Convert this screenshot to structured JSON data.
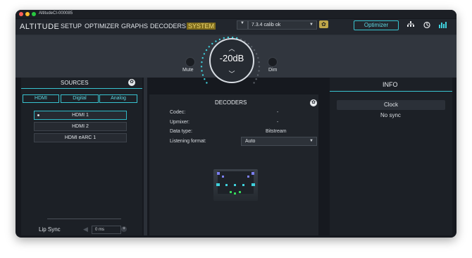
{
  "window": {
    "title": "AltitudeCI-000085"
  },
  "menu": {
    "logo": "ALTITUDE",
    "items": [
      "SETUP",
      "OPTIMIZER",
      "GRAPHS",
      "DECODERS",
      "SYSTEM"
    ],
    "active": "SYSTEM"
  },
  "toolbar": {
    "source_dropdown": "",
    "preset_dropdown": "7.3.4 calib ok",
    "optimizer_label": "Optimizer"
  },
  "volume": {
    "value": "-20dB",
    "mute_label": "Mute",
    "dim_label": "Dim"
  },
  "sources": {
    "title": "SOURCES",
    "tabs": [
      "HDMI",
      "Digital",
      "Analog"
    ],
    "items": [
      "HDMI 1",
      "HDMI 2",
      "HDMI eARC 1"
    ],
    "selected": "HDMI 1",
    "lipsync_label": "Lip Sync",
    "lipsync_value": "0 ms"
  },
  "decoders": {
    "title": "DECODERS",
    "rows": [
      {
        "label": "Codec:",
        "value": "-"
      },
      {
        "label": "Upmixer:",
        "value": "-"
      },
      {
        "label": "Data type:",
        "value": "Bitstream"
      }
    ],
    "listening_label": "Listening format:",
    "listening_value": "Auto"
  },
  "info": {
    "title": "INFO",
    "clock_label": "Clock",
    "clock_status": "No sync"
  },
  "colors": {
    "accent": "#38c3cf",
    "system_highlight": "#7d6a1c",
    "background": "#16191f"
  }
}
